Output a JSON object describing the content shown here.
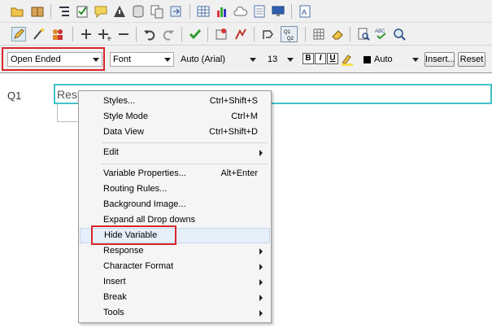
{
  "toolbar": {
    "row1_icons": [
      "open-folder-icon",
      "book-icon",
      "list-icon",
      "checklist-icon",
      "comment-icon",
      "warning-icon",
      "database-icon",
      "copy-icon",
      "export-icon",
      "table-icon",
      "bar-chart-icon",
      "cloud-icon",
      "document-icon",
      "monitor-icon",
      "text-document-icon"
    ],
    "row2_icons": [
      "design-mode-icon",
      "wand-icon",
      "users-icon",
      "add-icon",
      "add-child-icon",
      "remove-icon",
      "undo-icon",
      "redo-icon",
      "check-icon",
      "properties-icon",
      "routing-icon",
      "jump-icon",
      "q1-q2-icon",
      "grid-icon",
      "eraser-icon",
      "preview-icon",
      "spellcheck-icon",
      "search-icon"
    ]
  },
  "format_bar": {
    "question_type": "Open Ended",
    "style": "Font",
    "font": "Auto (Arial)",
    "size": "13",
    "bold": "B",
    "italic": "I",
    "underline": "U",
    "color": "Auto",
    "insert_label": "Insert...",
    "reset_label": "Reset",
    "swatch_color": "#000000"
  },
  "question": {
    "label": "Q1",
    "text": "Resp"
  },
  "context_menu": {
    "items": [
      {
        "label": "Styles...",
        "shortcut": "Ctrl+Shift+S"
      },
      {
        "label": "Style Mode",
        "shortcut": "Ctrl+M"
      },
      {
        "label": "Data View",
        "shortcut": "Ctrl+Shift+D"
      },
      {
        "label": "Edit",
        "shortcut": ""
      },
      {
        "label": "Variable Properties...",
        "shortcut": "Alt+Enter"
      },
      {
        "label": "Routing Rules...",
        "shortcut": ""
      },
      {
        "label": "Background Image...",
        "shortcut": ""
      },
      {
        "label": "Expand all Drop downs",
        "shortcut": ""
      },
      {
        "label": "Hide Variable",
        "shortcut": ""
      },
      {
        "label": "Response",
        "shortcut": ""
      },
      {
        "label": "Character Format",
        "shortcut": ""
      },
      {
        "label": "Insert",
        "shortcut": ""
      },
      {
        "label": "Break",
        "shortcut": ""
      },
      {
        "label": "Tools",
        "shortcut": ""
      }
    ]
  },
  "colors": {
    "highlight": "#d9262a",
    "selection_border": "#43c2c8"
  }
}
